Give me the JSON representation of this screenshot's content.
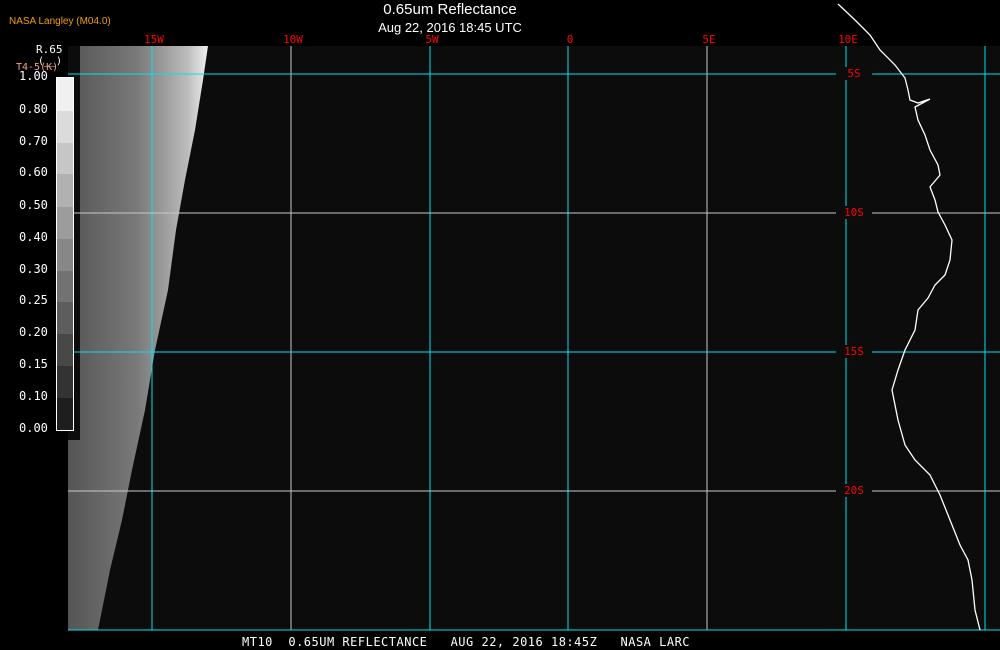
{
  "header": {
    "title": "0.65um Reflectance",
    "subtitle": "Aug 22, 2016 18:45 UTC",
    "credit": "NASA Langley (M04.0)"
  },
  "colorbar": {
    "title": "R.65",
    "unit": "(__)",
    "alt_label": "T4-5(K)",
    "labels": [
      "1.00",
      "0.80",
      "0.70",
      "0.60",
      "0.50",
      "0.40",
      "0.30",
      "0.25",
      "0.20",
      "0.15",
      "0.10",
      "0.00"
    ]
  },
  "map": {
    "lon_labels": [
      "15W",
      "10W",
      "5W",
      "0",
      "5E",
      "10E"
    ],
    "lat_labels": [
      "5S",
      "10S",
      "15S",
      "20S"
    ],
    "colors": {
      "grid": "#00e5ee",
      "label": "#ff0000",
      "coast": "#ffffff",
      "background": "#0c0c0c"
    }
  },
  "footer": {
    "caption": "MT10  0.65UM REFLECTANCE   AUG 22, 2016 18:45Z   NASA LARC"
  }
}
